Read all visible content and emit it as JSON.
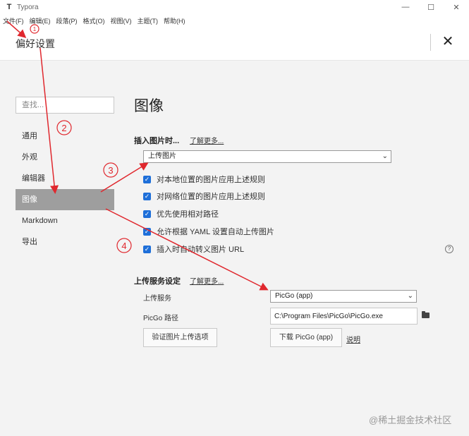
{
  "window": {
    "app_name": "Typora",
    "app_icon": "T",
    "minimize": "—",
    "maximize": "☐",
    "close": "✕"
  },
  "menu": [
    "文件(F)",
    "编辑(E)",
    "段落(P)",
    "格式(O)",
    "视图(V)",
    "主题(T)",
    "帮助(H)"
  ],
  "header": {
    "title": "偏好设置",
    "close_label": "✕"
  },
  "sidebar": {
    "search_placeholder": "查找...",
    "items": [
      "通用",
      "外观",
      "编辑器",
      "图像",
      "Markdown",
      "导出"
    ],
    "active_index": 3
  },
  "main": {
    "title": "图像",
    "insert_section": {
      "title": "插入图片时...",
      "learn_more": "了解更多...",
      "select_value": "上传图片",
      "options": [
        {
          "label": "对本地位置的图片应用上述规则",
          "checked": true
        },
        {
          "label": "对网络位置的图片应用上述规则",
          "checked": true
        },
        {
          "label": "优先使用相对路径",
          "checked": true
        },
        {
          "label": "允许根据 YAML 设置自动上传图片",
          "checked": true
        },
        {
          "label": "插入时自动转义图片 URL",
          "checked": true
        }
      ],
      "help": "?"
    },
    "upload_section": {
      "title": "上传服务设定",
      "learn_more": "了解更多...",
      "service_label": "上传服务",
      "service_value": "PicGo (app)",
      "path_label": "PicGo 路径",
      "path_value": "C:\\Program Files\\PicGo\\PicGo.exe",
      "verify_button": "验证图片上传选项",
      "download_button": "下载 PicGo (app)",
      "explain_link": "说明"
    }
  },
  "annotations": {
    "markers": [
      "①",
      "②",
      "③",
      "④"
    ],
    "color": "#e0282e"
  },
  "watermark": "@稀土掘金技术社区"
}
